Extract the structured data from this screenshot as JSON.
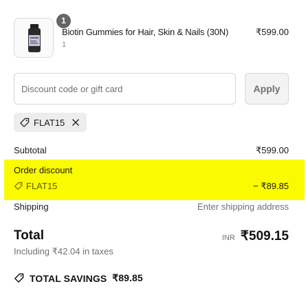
{
  "product": {
    "image_icon": "biotin-gummies-bottle",
    "quantity_badge": "1",
    "name": "Biotin Gummies for Hair, Skin & Nails (30N)",
    "variant": "1",
    "price": "₹599.00"
  },
  "discount": {
    "placeholder": "Discount code or gift card",
    "apply_label": "Apply",
    "applied_code": "FLAT15",
    "tag_icon": "tag-icon",
    "remove_icon": "close-icon"
  },
  "summary": {
    "subtotal_label": "Subtotal",
    "subtotal_value": "₹599.00",
    "order_discount_label": "Order discount",
    "order_discount_code": "FLAT15",
    "order_discount_value": "− ₹89.85",
    "shipping_label": "Shipping",
    "shipping_value": "Enter shipping address",
    "total_label": "Total",
    "currency": "INR",
    "total_value": "₹509.15",
    "taxes_note": "Including ₹42.04 in taxes",
    "savings_label": "TOTAL SAVINGS",
    "savings_value": "₹89.85"
  },
  "colors": {
    "highlight": "#fafa00",
    "badge": "#666666",
    "muted_text": "#707070"
  }
}
